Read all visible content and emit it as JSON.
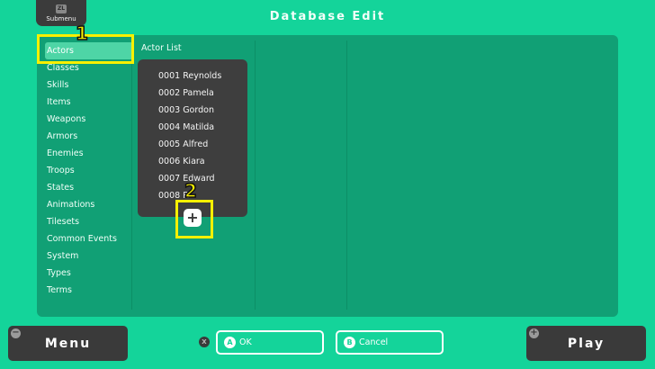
{
  "header": {
    "submenu_badge": "ZL",
    "submenu_label": "Submenu",
    "title": "Database Edit"
  },
  "sidebar": {
    "items": [
      {
        "label": "Actors",
        "selected": true
      },
      {
        "label": "Classes"
      },
      {
        "label": "Skills"
      },
      {
        "label": "Items"
      },
      {
        "label": "Weapons"
      },
      {
        "label": "Armors"
      },
      {
        "label": "Enemies"
      },
      {
        "label": "Troops"
      },
      {
        "label": "States"
      },
      {
        "label": "Animations"
      },
      {
        "label": "Tilesets"
      },
      {
        "label": "Common Events"
      },
      {
        "label": "System"
      },
      {
        "label": "Types"
      },
      {
        "label": "Terms"
      }
    ]
  },
  "actor_list": {
    "label": "Actor List",
    "actors": [
      "0001 Reynolds",
      "0002 Pamela",
      "0003 Gordon",
      "0004 Matilda",
      "0005 Alfred",
      "0006 Kiara",
      "0007 Edward",
      "0008 R"
    ],
    "add_glyph": "+"
  },
  "callouts": {
    "one": "1",
    "two": "2",
    "color": "#f7f000"
  },
  "footer": {
    "menu_label": "Menu",
    "menu_corner_glyph": "−",
    "play_label": "Play",
    "play_corner_glyph": "+",
    "x_badge": "X",
    "ok_badge": "A",
    "ok_label": "OK",
    "cancel_badge": "B",
    "cancel_label": "Cancel"
  },
  "colors": {
    "background": "#14d49a",
    "panel": "#11a075",
    "selected": "#4ed5a6",
    "dark": "#3a3a3a"
  }
}
